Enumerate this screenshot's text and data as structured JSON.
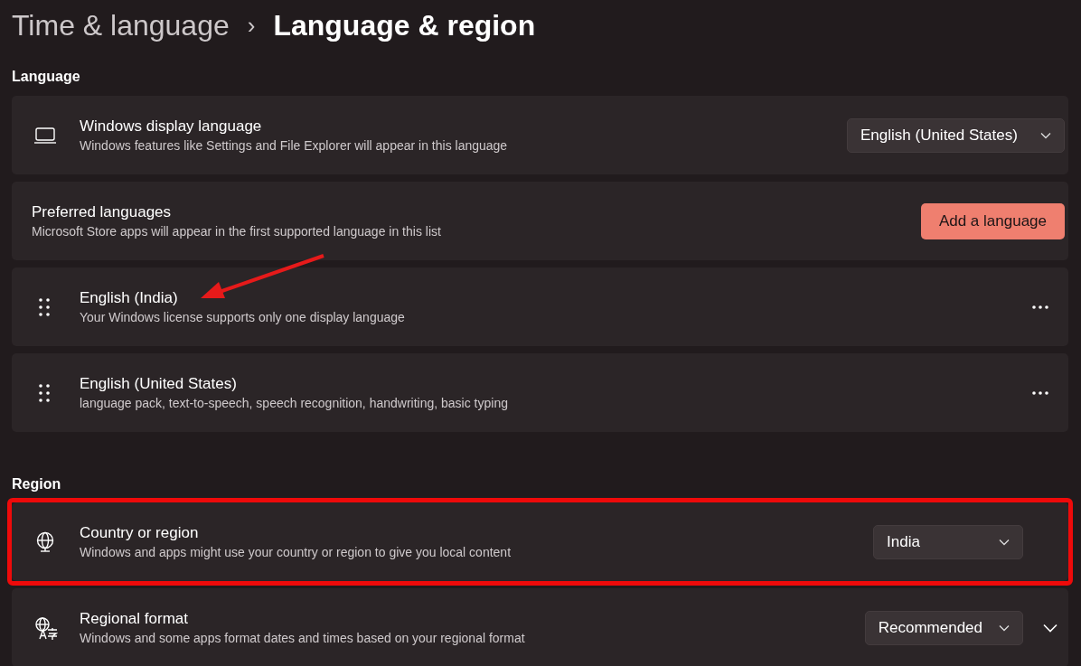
{
  "breadcrumb": {
    "parent": "Time & language",
    "separator": "›",
    "current": "Language & region"
  },
  "sections": [
    {
      "heading": "Language",
      "rows": [
        {
          "kind": "setting",
          "title": "Windows display language",
          "subtitle": "Windows features like Settings and File Explorer will appear in this language",
          "control": {
            "kind": "dropdown",
            "value": "English (United States)"
          }
        },
        {
          "kind": "setting",
          "title": "Preferred languages",
          "subtitle": "Microsoft Store apps will appear in the first supported language in this list",
          "control": {
            "kind": "accent_button",
            "label": "Add a language"
          }
        },
        {
          "kind": "language",
          "title": "English (India)",
          "subtitle": "Your Windows license supports only one display language",
          "pointed": true
        },
        {
          "kind": "language",
          "title": "English (United States)",
          "subtitle": "language pack, text-to-speech, speech recognition, handwriting, basic typing",
          "pointed": false
        }
      ]
    },
    {
      "heading": "Region",
      "rows": [
        {
          "kind": "setting",
          "title": "Country or region",
          "subtitle": "Windows and apps might use your country or region to give you local content",
          "control": {
            "kind": "dropdown",
            "value": "India"
          },
          "highlighted": true,
          "expandable": false
        },
        {
          "kind": "setting",
          "title": "Regional format",
          "subtitle": "Windows and some apps format dates and times based on your regional format",
          "control": {
            "kind": "dropdown",
            "value": "Recommended"
          },
          "highlighted": false,
          "expandable": true
        }
      ]
    }
  ]
}
